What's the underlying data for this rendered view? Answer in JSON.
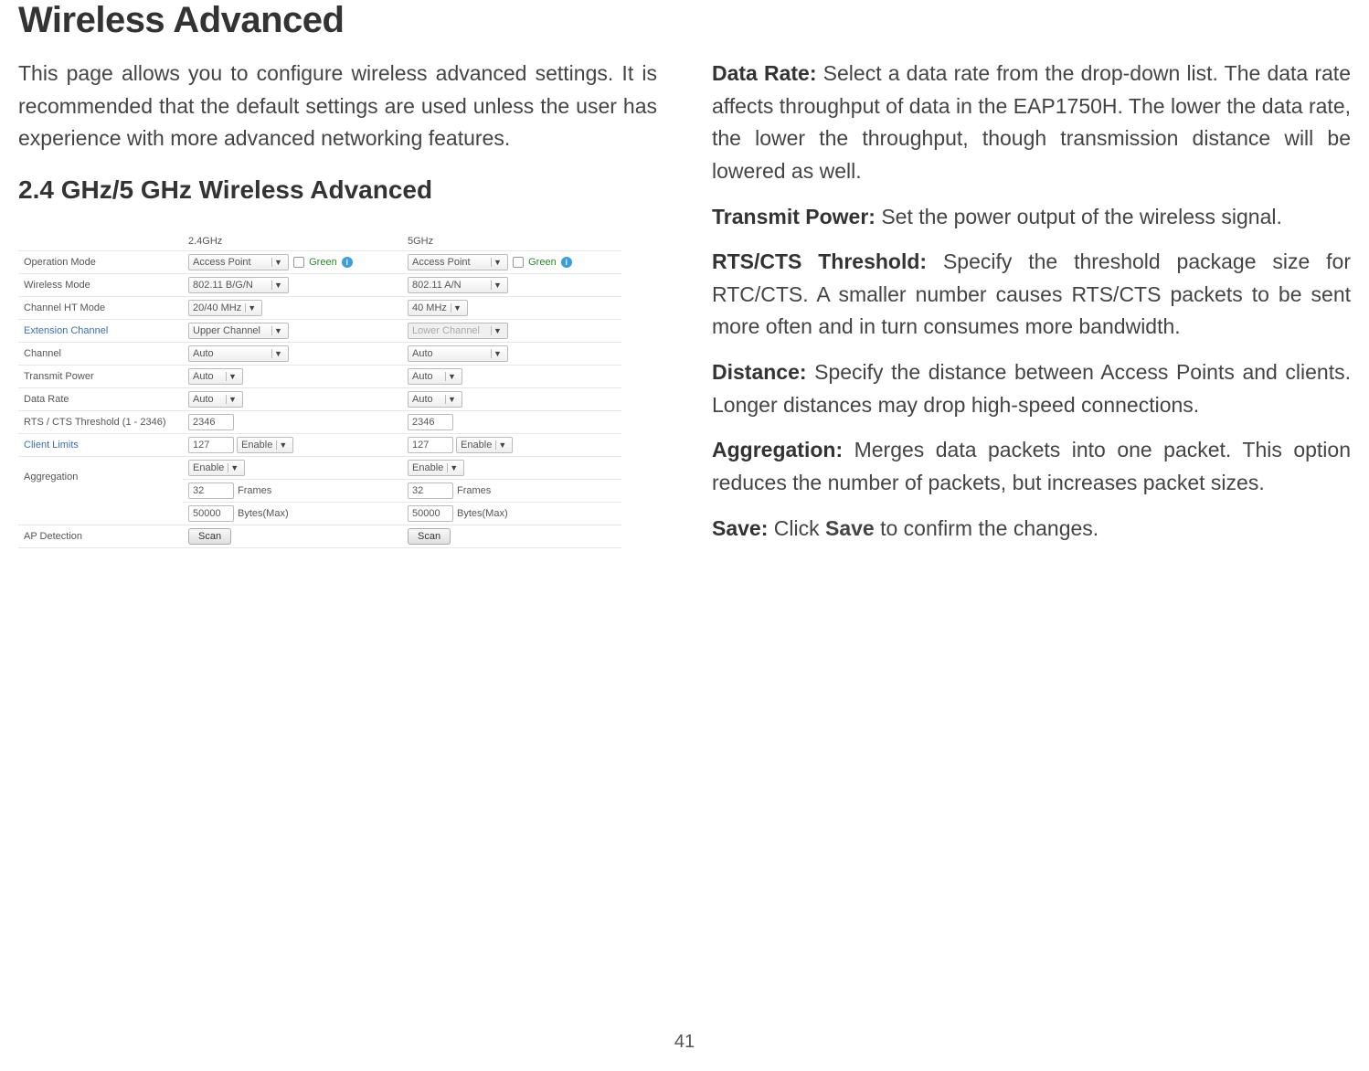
{
  "page_title": "Wireless Advanced",
  "intro": "This page allows you to configure wireless advanced settings. It is recommended that the default settings are used unless the user has experience with more advanced networking features.",
  "section_title": "2.4 GHz/5 GHz Wireless Advanced",
  "page_number": "41",
  "settings": {
    "col_headers": {
      "c1": "2.4GHz",
      "c2": "5GHz"
    },
    "rows": {
      "operation_mode": {
        "label": "Operation Mode",
        "v1": "Access Point",
        "v2": "Access Point",
        "green": "Green"
      },
      "wireless_mode": {
        "label": "Wireless Mode",
        "v1": "802.11 B/G/N",
        "v2": "802.11 A/N"
      },
      "channel_ht": {
        "label": "Channel HT Mode",
        "v1": "20/40 MHz",
        "v2": "40 MHz"
      },
      "extension_channel": {
        "label": "Extension Channel",
        "v1": "Upper Channel",
        "v2": "Lower Channel"
      },
      "channel": {
        "label": "Channel",
        "v1": "Auto",
        "v2": "Auto"
      },
      "transmit_power": {
        "label": "Transmit Power",
        "v1": "Auto",
        "v2": "Auto"
      },
      "data_rate": {
        "label": "Data Rate",
        "v1": "Auto",
        "v2": "Auto"
      },
      "rts": {
        "label": "RTS / CTS Threshold (1 - 2346)",
        "v1": "2346",
        "v2": "2346"
      },
      "client_limits": {
        "label": "Client Limits",
        "v1": "127",
        "v2": "127",
        "enable": "Enable"
      },
      "aggregation": {
        "label": "Aggregation",
        "enable": "Enable",
        "frames_v": "32",
        "frames_l": "Frames",
        "bytes_v": "50000",
        "bytes_l": "Bytes(Max)"
      },
      "ap_detection": {
        "label": "AP Detection",
        "btn": "Scan"
      }
    }
  },
  "terms": {
    "data_rate": {
      "term": "Data Rate:",
      "desc": " Select a data rate from the drop-down list. The data rate affects throughput of data in the EAP1750H. The lower the data rate, the lower the throughput, though transmission distance will be lowered as well."
    },
    "transmit_power": {
      "term": "Transmit Power:",
      "desc": " Set the power output of the wireless signal."
    },
    "rts": {
      "term": "RTS/CTS Threshold:",
      "desc": " Specify the threshold package size for RTC/CTS. A smaller number causes RTS/CTS packets to be sent more often and in turn consumes more bandwidth."
    },
    "distance": {
      "term": "Distance:",
      "desc": " Specify the distance between Access Points and clients. Longer distances may drop high-speed connections."
    },
    "aggregation": {
      "term": "Aggregation:",
      "desc": " Merges data packets into one packet. This option reduces the number of packets, but increases packet sizes."
    },
    "save": {
      "term": "Save:",
      "pre": " Click ",
      "bold": "Save",
      "post": " to confirm the changes."
    }
  }
}
